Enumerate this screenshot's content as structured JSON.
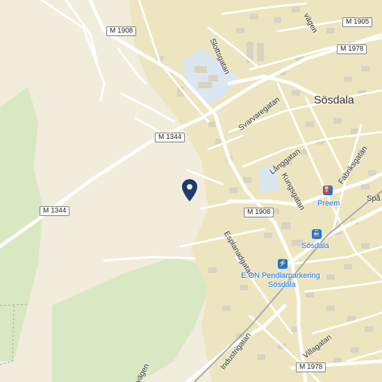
{
  "map": {
    "town_label": "Sösdala",
    "route_shields": [
      "M 1908",
      "M 1905",
      "M 1978",
      "M 1344",
      "M 1344",
      "M 1908",
      "M 1978"
    ],
    "streets": [
      "Slottsgatan",
      "Svarvaregatan",
      "Långgatan",
      "Kungsgatan",
      "Fabriksgatan",
      "Esplanadgatan",
      "Industrigatan",
      "Villagatan",
      "vägen",
      "vägen",
      "Spå"
    ],
    "pois": {
      "preem": {
        "label": "Preem",
        "icon": "fuel-station-icon"
      },
      "station": {
        "label": "Sösdala",
        "icon": "train-station-icon"
      },
      "parking": {
        "label_line1": "E.ON Pendlarparkering",
        "label_line2": "Sösdala",
        "icon": "ev-charging-icon"
      }
    },
    "pin": {
      "icon": "location-pin-icon",
      "color": "#1f3a6e"
    },
    "colors": {
      "land": "#f1ecdc",
      "forest": "#d8e8c2",
      "urban": "#ece5bf",
      "road": "#ffffff",
      "building": "#d9d3c1",
      "school": "#dbe7f0",
      "poi_blue": "#1a73e8"
    }
  }
}
